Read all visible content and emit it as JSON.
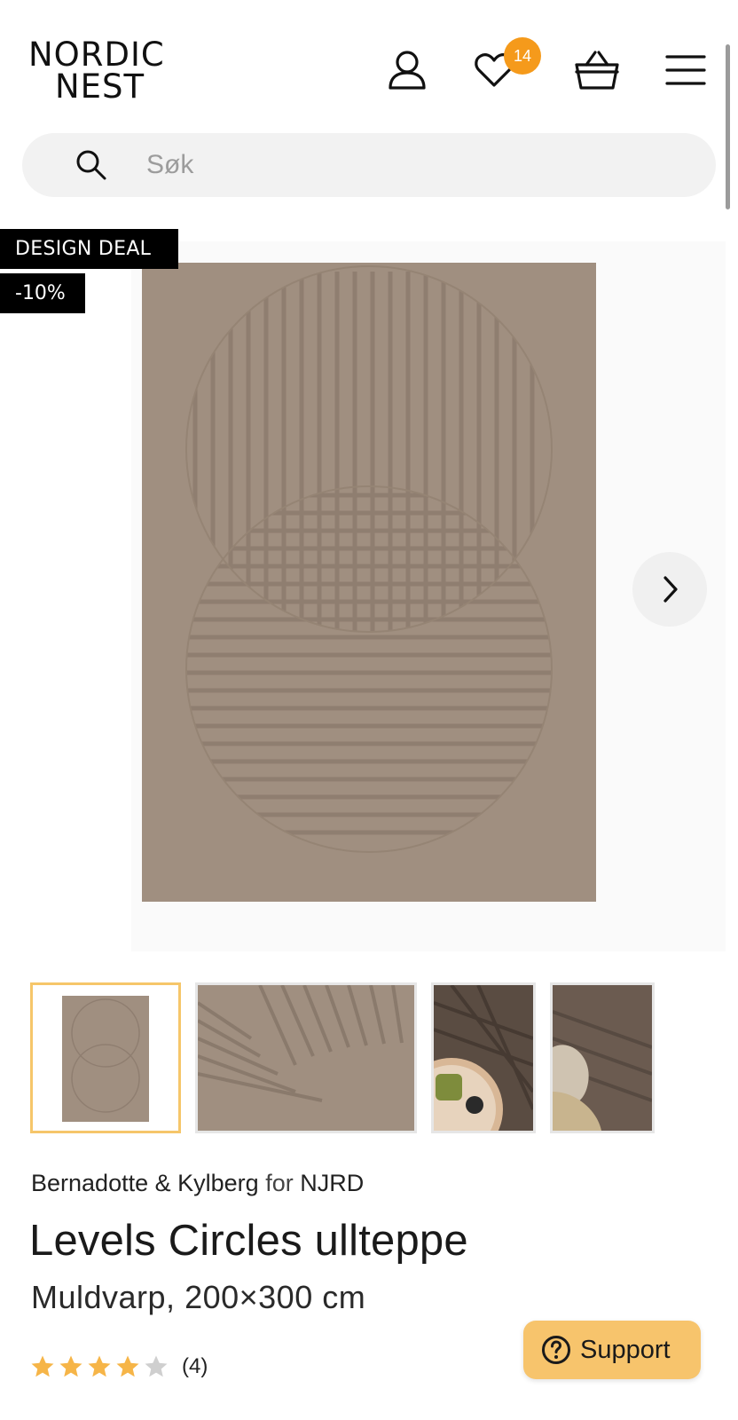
{
  "header": {
    "logo_line1": "NORDIC",
    "logo_line2": "NEST",
    "wishlist_count": "14",
    "icons": [
      "account-icon",
      "wishlist-heart-icon",
      "basket-icon",
      "menu-icon"
    ]
  },
  "search": {
    "placeholder": "Søk",
    "value": ""
  },
  "badges": {
    "deal_label": "DESIGN DEAL",
    "discount": "-10%"
  },
  "gallery": {
    "next_icon": "chevron-right-icon",
    "thumbnails": [
      "rug-front-view",
      "rug-close-up-pattern",
      "rug-lifestyle-table",
      "rug-lifestyle-pillow"
    ],
    "active_index": 0
  },
  "product": {
    "brand": "Bernadotte & Kylberg",
    "for_word": "for",
    "maker": "NJRD",
    "title": "Levels Circles ullteppe",
    "variant": "Muldvarp, 200×300 cm",
    "rating_value": 4,
    "rating_max": 5,
    "rating_count": "(4)"
  },
  "support": {
    "label": "Support",
    "icon": "question-circle-icon"
  },
  "colors": {
    "accent_orange": "#f59a1b",
    "support_yellow": "#f7c46c",
    "rug_color": "#a08f80",
    "star_filled": "#f6b548",
    "star_empty": "#cfcfcf"
  }
}
